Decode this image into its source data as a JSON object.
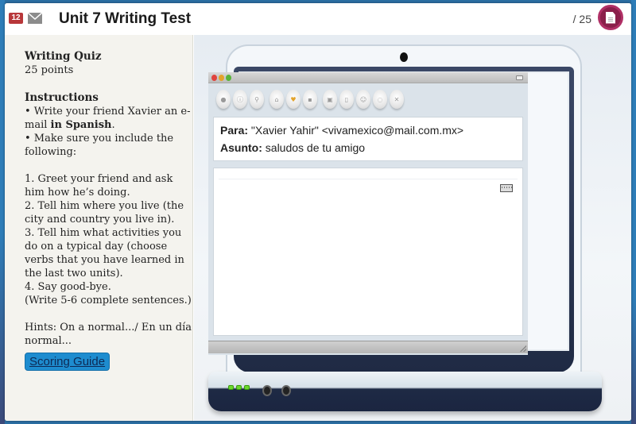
{
  "header": {
    "badge_count": "12",
    "mail_icon": "envelope-icon",
    "title": "Unit 7 Writing Test",
    "score": "/ 25",
    "document_icon": "document-icon"
  },
  "instructions": {
    "quiz_title": "Writing Quiz",
    "points": "25 points",
    "heading": "Instructions",
    "bullet1_prefix": "• Write your friend Xavier an e-mail ",
    "bullet1_bold": "in Spanish",
    "bullet1_suffix": ".",
    "bullet2": "• Make sure you include the following:",
    "items": [
      "1. Greet your friend and ask him how he’s doing.",
      "2. Tell him where you live (the city and country you live in).",
      "3. Tell him what activities you do on a typical day (choose verbs that you have learned in the last two units).",
      "4. Say good-bye."
    ],
    "note": "(Write 5-6 complete sentences.)",
    "hints": "Hints: On a normal.../ En un día normal...",
    "scoring_guide": "Scoring Guide"
  },
  "email": {
    "to_label": "Para:",
    "to_value": "\"Xavier Yahir\" <vivamexico@mail.com.mx>",
    "subject_label": "Asunto:",
    "subject_value": "saludos de tu amigo",
    "body": "",
    "toolbar_icons": [
      "reply-icon",
      "info-icon",
      "search-icon",
      "home-icon",
      "favorite-icon",
      "save-icon",
      "calendar-icon",
      "trash-icon",
      "contact-icon",
      "chat-icon",
      "close-icon"
    ],
    "window_buttons": [
      "close-dot",
      "minimize-dot",
      "zoom-dot"
    ],
    "keyboard_icon": "keyboard-icon"
  },
  "colors": {
    "badge": "#b8373a",
    "doc_button": "#8a1f4a",
    "scoring_button": "#1e8ccf",
    "led": "#6bd82c"
  }
}
